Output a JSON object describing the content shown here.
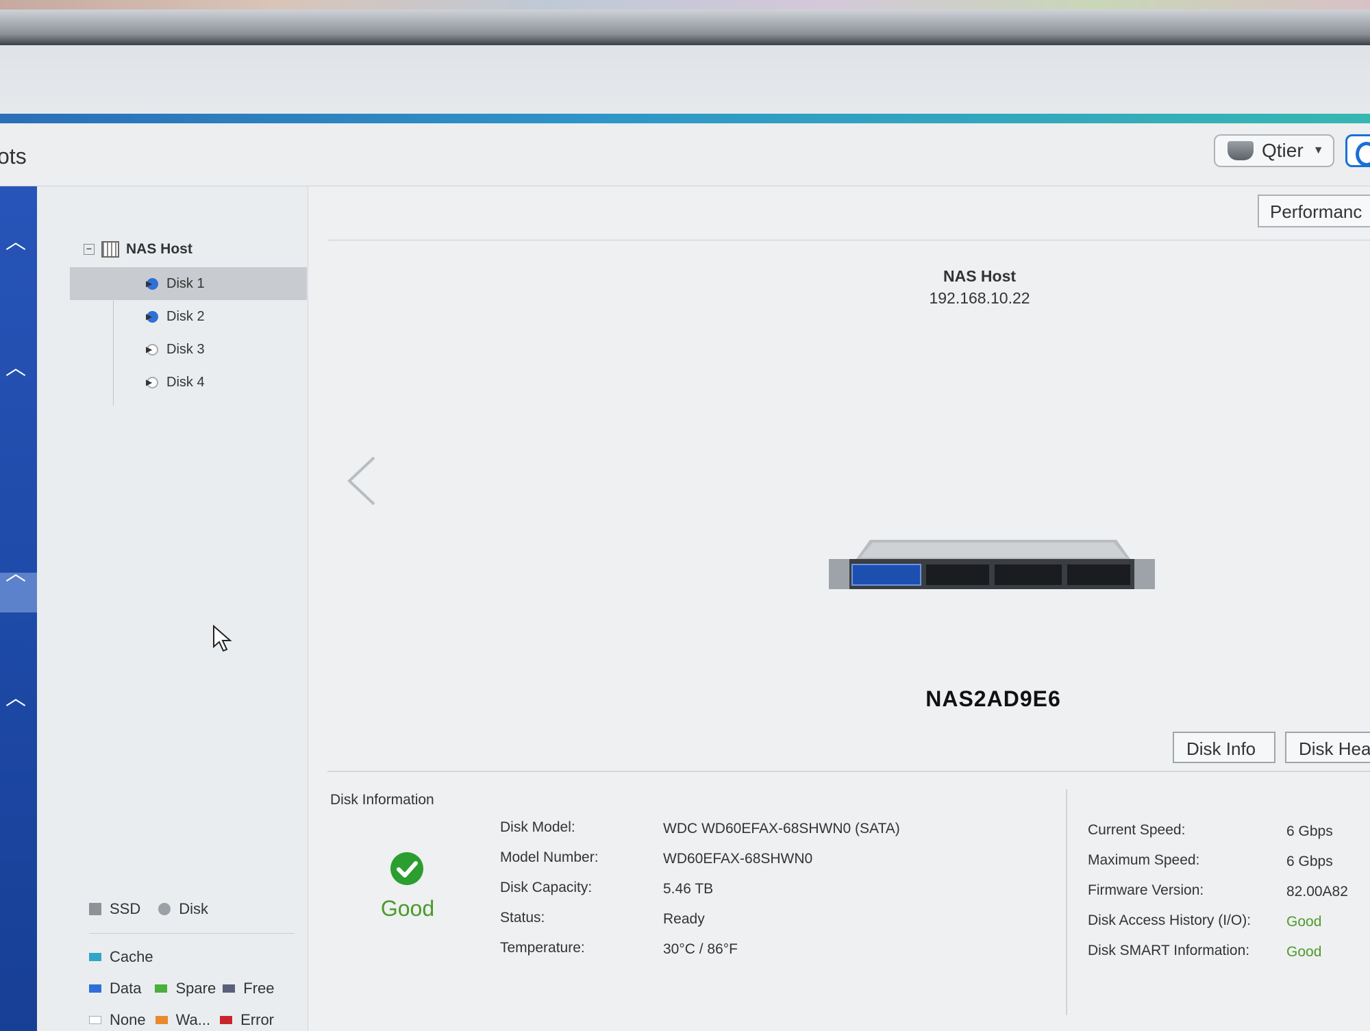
{
  "window": {
    "title_fragment": "ots"
  },
  "toolbar": {
    "qtier_label": "Qtier"
  },
  "tree": {
    "root_label": "NAS Host",
    "disks": [
      {
        "label": "Disk 1",
        "state": "filled",
        "selected": true
      },
      {
        "label": "Disk 2",
        "state": "filled",
        "selected": false
      },
      {
        "label": "Disk 3",
        "state": "empty",
        "selected": false
      },
      {
        "label": "Disk 4",
        "state": "empty",
        "selected": false
      }
    ]
  },
  "legend": {
    "ssd": "SSD",
    "disk": "Disk",
    "cache": "Cache",
    "data": "Data",
    "spare": "Spare",
    "free": "Free",
    "none": "None",
    "warning": "Wa...",
    "error": "Error",
    "colors": {
      "ssd": "#8e9297",
      "disk": "#9aa0a6",
      "cache": "#2fa6c8",
      "data": "#2f6fd8",
      "spare": "#4cae3c",
      "free": "#5a5f7a",
      "none": "#ffffff",
      "warning": "#e88a2c",
      "error": "#c8262c"
    }
  },
  "main": {
    "performance_label": "Performanc",
    "host_name": "NAS Host",
    "host_ip": "192.168.10.22",
    "device_name": "NAS2AD9E6",
    "tabs": {
      "disk_info": "Disk Info",
      "disk_health": "Disk Hea"
    }
  },
  "disk_info": {
    "heading": "Disk Information",
    "health": "Good",
    "fields_left": [
      {
        "label": "Disk Model:",
        "value": "WDC WD60EFAX-68SHWN0 (SATA)"
      },
      {
        "label": "Model Number:",
        "value": "WD60EFAX-68SHWN0"
      },
      {
        "label": "Disk Capacity:",
        "value": "5.46 TB"
      },
      {
        "label": "Status:",
        "value": "Ready"
      },
      {
        "label": "Temperature:",
        "value": "30°C / 86°F"
      }
    ],
    "fields_right": [
      {
        "label": "Current Speed:",
        "value": "6 Gbps"
      },
      {
        "label": "Maximum Speed:",
        "value": "6 Gbps"
      },
      {
        "label": "Firmware Version:",
        "value": "82.00A82"
      },
      {
        "label": "Disk Access History (I/O):",
        "value": "Good"
      },
      {
        "label": "Disk SMART Information:",
        "value": "Good"
      }
    ]
  }
}
